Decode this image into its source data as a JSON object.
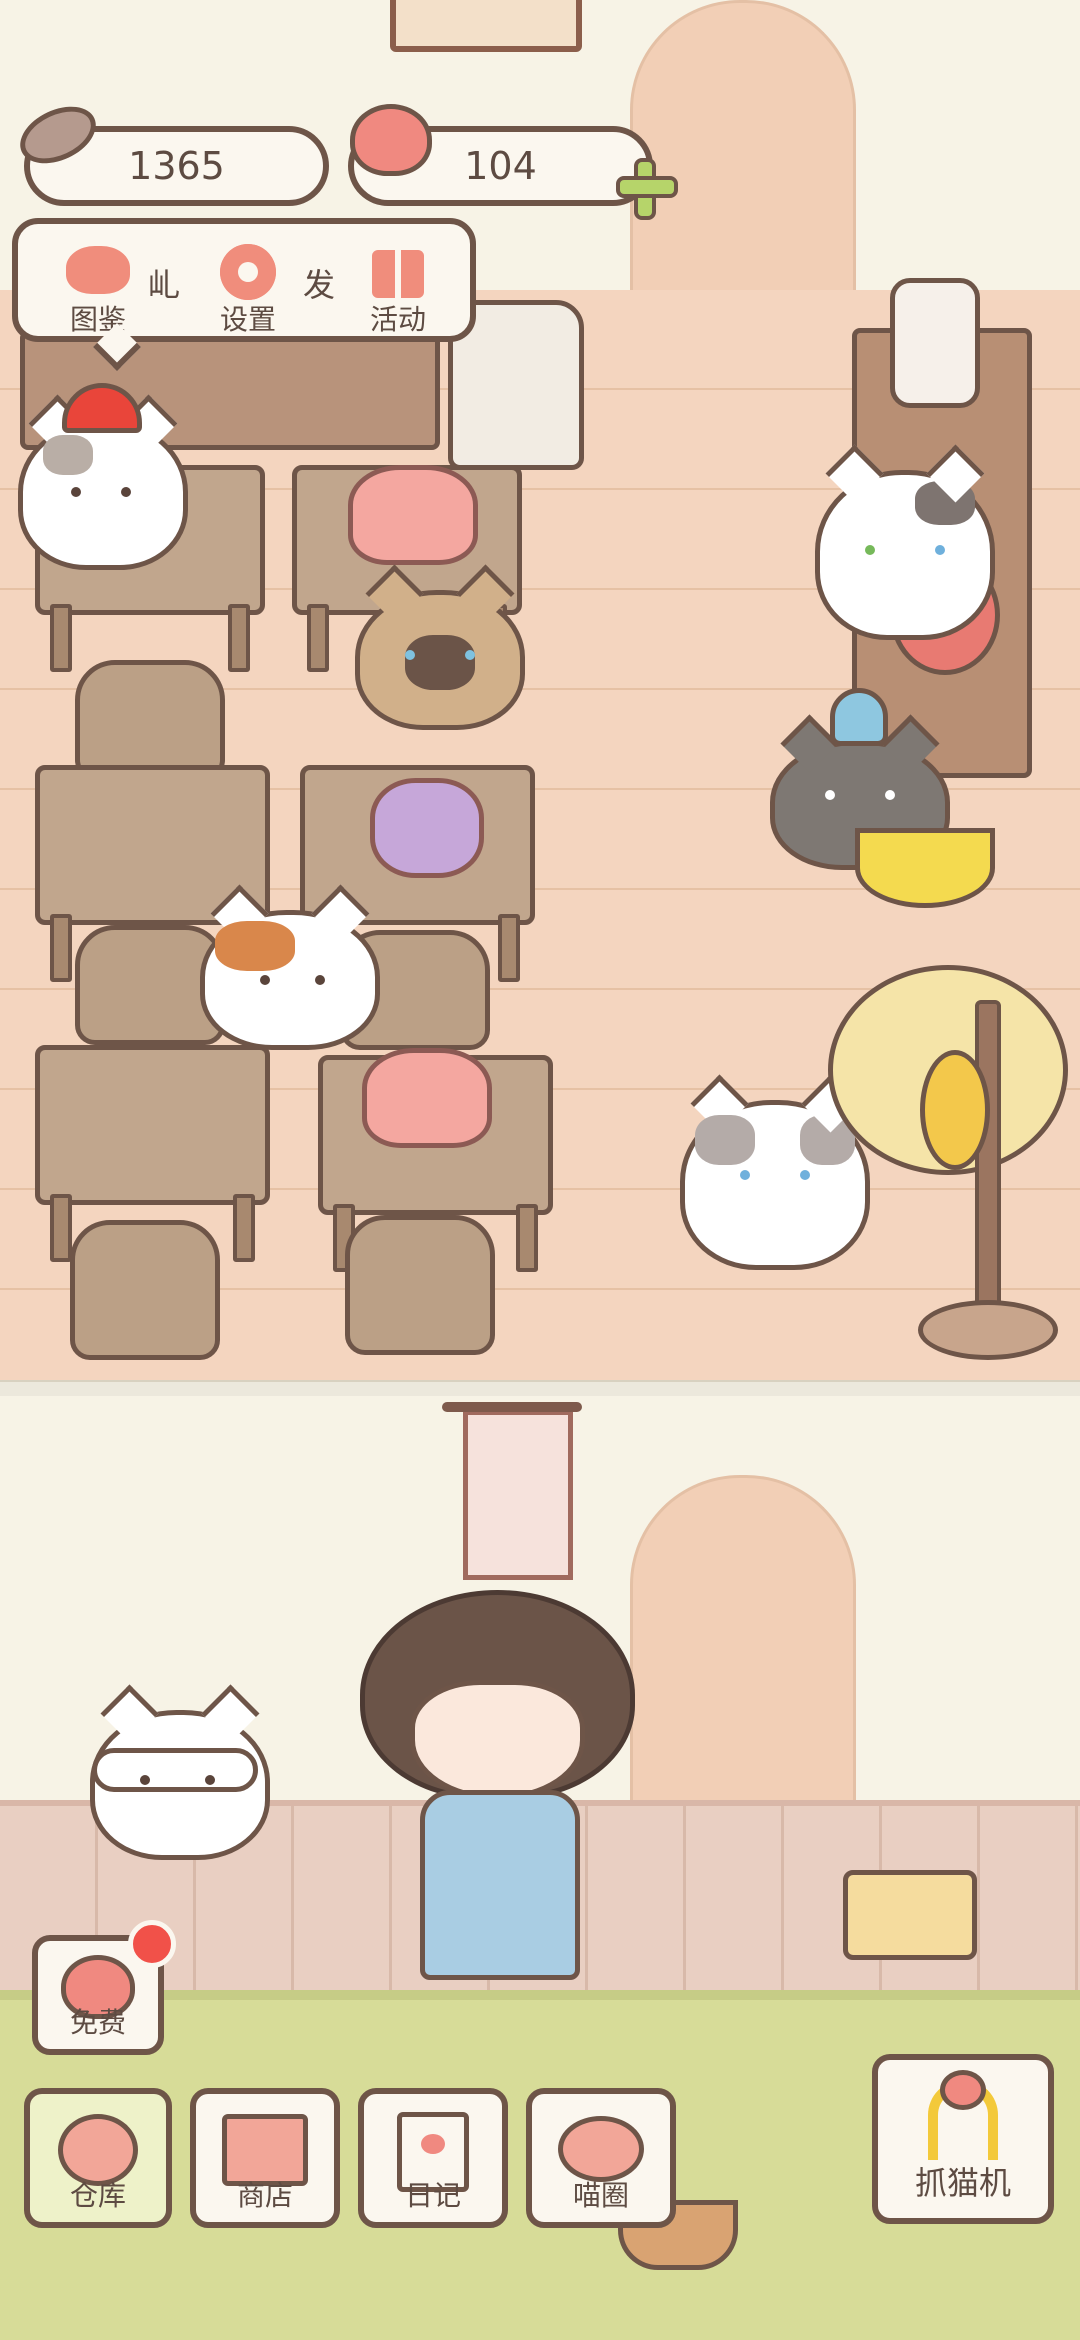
{
  "hud": {
    "fish_count": "1365",
    "heart_count": "104"
  },
  "menu": {
    "items": [
      {
        "label": "图鉴",
        "icon": "cat-face-icon"
      },
      {
        "label": "设置",
        "icon": "gear-icon"
      },
      {
        "label": "活动",
        "icon": "gift-icon"
      }
    ],
    "hidden_chars": [
      "乢",
      "发"
    ]
  },
  "free_button": {
    "label": "免费",
    "icon": "heart-icon"
  },
  "bottom_bar": {
    "items": [
      {
        "label": "仓库",
        "icon": "storage-icon"
      },
      {
        "label": "商店",
        "icon": "shop-icon"
      },
      {
        "label": "日记",
        "icon": "diary-icon"
      },
      {
        "label": "喵圈",
        "icon": "cat-planet-icon"
      }
    ],
    "claw_machine": {
      "label": "抓猫机",
      "icon": "claw-icon"
    }
  },
  "colors": {
    "outline": "#6e5548",
    "floor": "#f4d5bf",
    "wall": "#f7f3e6",
    "grass": "#d7dc98",
    "heart": "#f08980",
    "badge": "#f15149"
  }
}
